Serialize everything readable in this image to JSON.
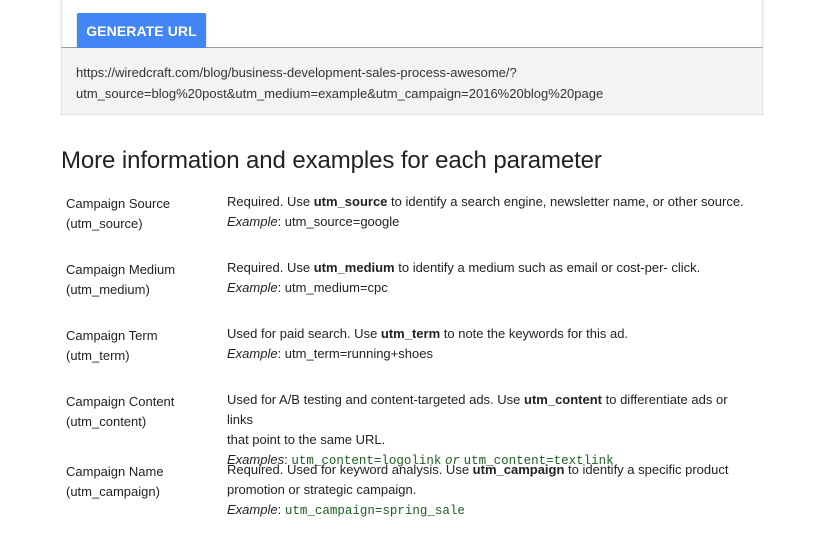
{
  "tool": {
    "generate_button": "GENERATE URL",
    "url_line1": "https://wiredcraft.com/blog/business-development-sales-process-awesome/?",
    "url_line2": "utm_source=blog%20post&utm_medium=example&utm_campaign=2016%20blog%20page"
  },
  "section": {
    "heading": "More information and examples for each parameter"
  },
  "params": [
    {
      "name": "Campaign Source",
      "key": "(utm_source)",
      "desc_pre": "Required. Use ",
      "desc_bold": "utm_source",
      "desc_post": " to identify a search engine, newsletter name, or other source.",
      "example_label": "Example",
      "example_value": ": utm_source=google"
    },
    {
      "name": "Campaign Medium",
      "key": "(utm_medium)",
      "desc_pre": "Required. Use ",
      "desc_bold": "utm_medium",
      "desc_post": " to identify a medium such as email or cost-per- click.",
      "example_label": "Example",
      "example_value": ": utm_medium=cpc"
    },
    {
      "name": "Campaign Term",
      "key": "(utm_term)",
      "desc_pre": "Used for paid search. Use ",
      "desc_bold": "utm_term",
      "desc_post": " to note the keywords for this ad.",
      "example_label": "Example",
      "example_value": ": utm_term=running+shoes"
    },
    {
      "name": "Campaign Content",
      "key": "(utm_content)",
      "desc_pre": "Used for A/B testing and content-targeted ads. Use ",
      "desc_bold": "utm_content",
      "desc_post": " to differentiate ads or links",
      "desc_line2": "that point to the same URL.",
      "example_label": "Examples",
      "example_sep": ": ",
      "example_code1": "utm_content=logolink",
      "example_or": "or",
      "example_code2": "utm_content=textlink"
    },
    {
      "name": "Campaign Name",
      "key": "(utm_campaign)",
      "desc_pre": "Required. Used for keyword analysis. Use ",
      "desc_bold": "utm_campaign",
      "desc_post": " to identify a specific product",
      "desc_line2": "promotion or strategic campaign.",
      "example_label": "Example",
      "example_sep": ": ",
      "example_code1": "utm_campaign=spring_sale"
    }
  ]
}
